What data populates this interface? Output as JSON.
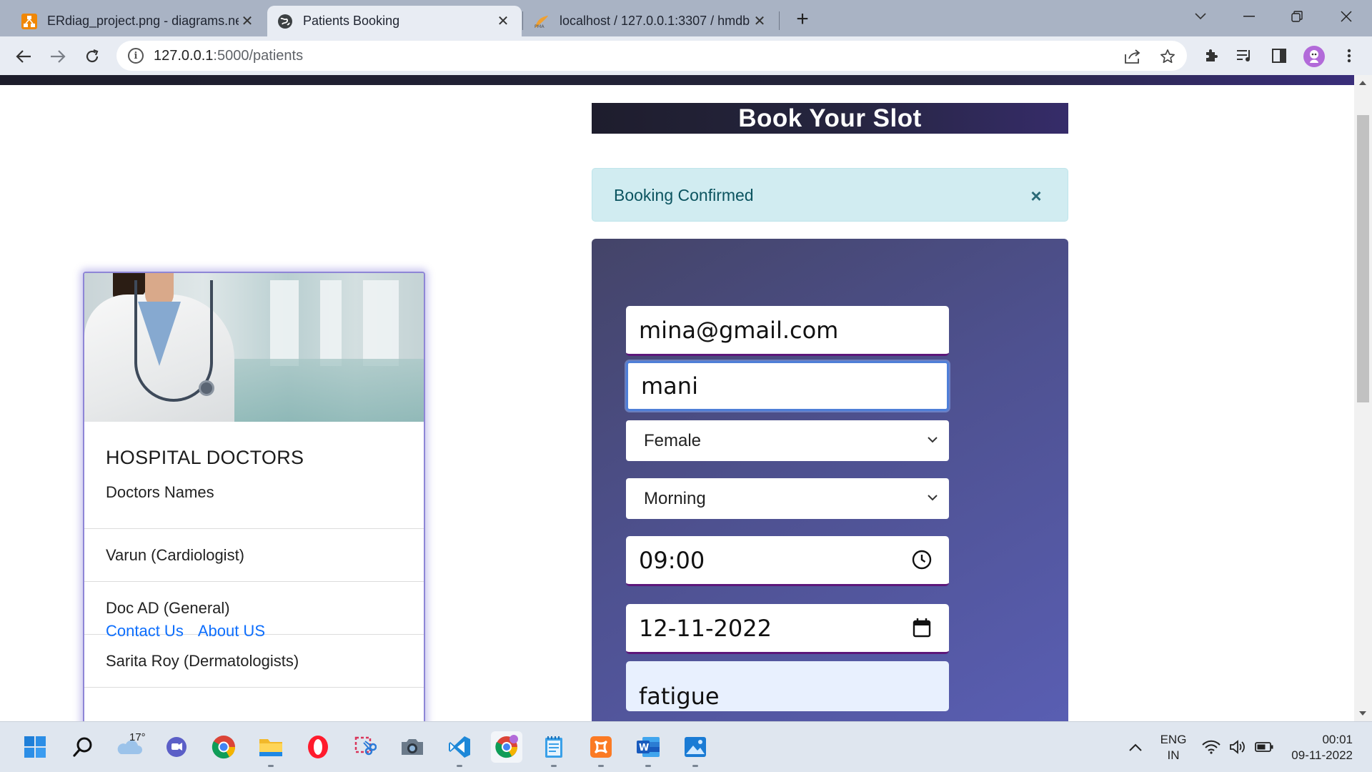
{
  "browser": {
    "tabs": [
      {
        "title": "ERdiag_project.png - diagrams.net",
        "icon": "drawio-icon",
        "active": false
      },
      {
        "title": "Patients Booking",
        "icon": "globe-icon",
        "active": true
      },
      {
        "title": "localhost / 127.0.0.1:3307 / hmdb",
        "icon": "phpmyadmin-icon",
        "active": false
      }
    ],
    "address": {
      "host": "127.0.0.1",
      "path": ":5000/patients"
    }
  },
  "page": {
    "card": {
      "title": "HOSPITAL DOCTORS",
      "subtitle": "Doctors Names",
      "doctors": [
        "Varun (Cardiologist)",
        "Doc AD (General)",
        "Sarita Roy (Dermatologists)"
      ],
      "links": [
        "Contact Us",
        "About US"
      ]
    },
    "header": "Book Your Slot",
    "alert": {
      "text": "Booking Confirmed",
      "close": "×"
    },
    "form": {
      "email": "mina@gmail.com",
      "name": "mani",
      "gender": "Female",
      "shift": "Morning",
      "time": "09:00",
      "date": "12-11-2022",
      "symptoms": "fatigue"
    }
  },
  "taskbar": {
    "weather": "17°",
    "language": [
      "ENG",
      "IN"
    ],
    "clock": {
      "time": "00:01",
      "date": "09-11-2022"
    }
  },
  "colors": {
    "header_bg": "#262540",
    "panel_start": "#444468",
    "panel_end": "#5a5fb5",
    "alert_bg": "#d1ecf1",
    "alert_text": "#0c5460",
    "field_underline": "#5d177a",
    "link": "#0d6efd"
  }
}
